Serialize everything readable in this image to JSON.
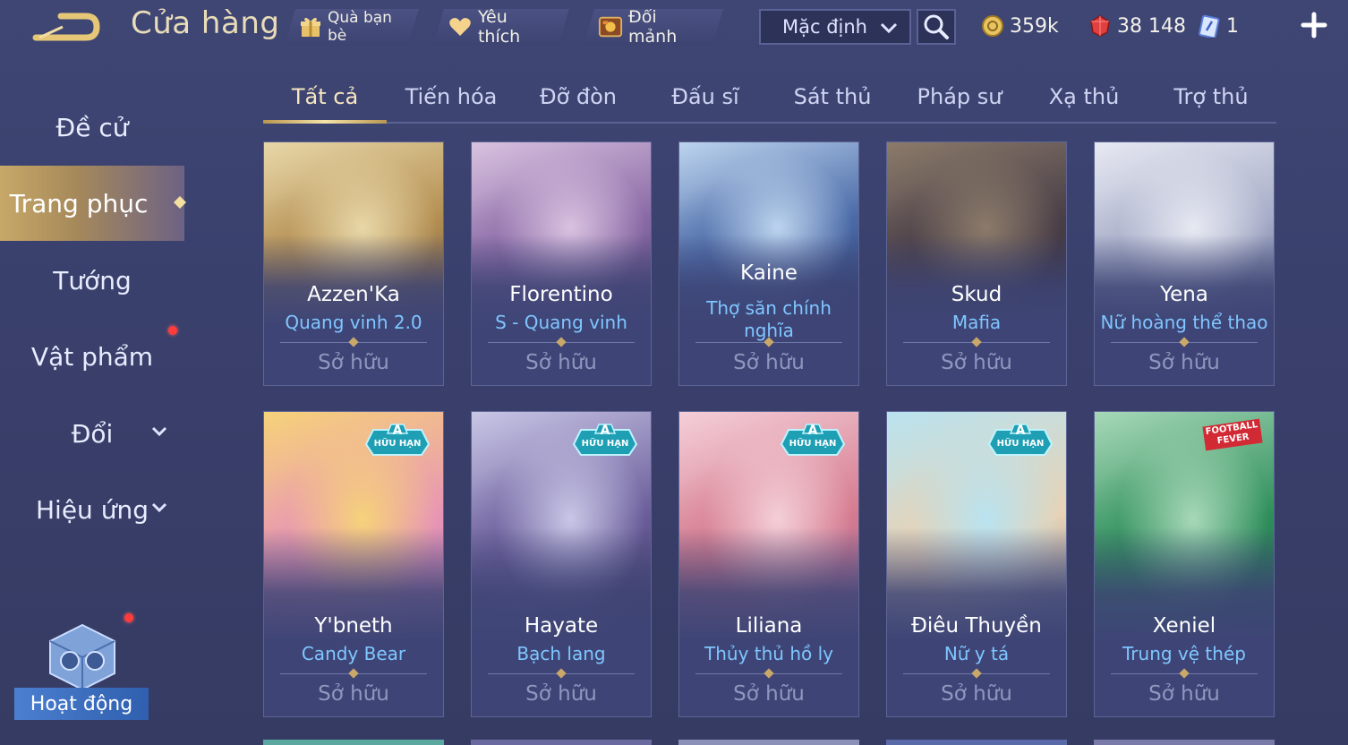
{
  "header": {
    "title": "Cửa hàng",
    "buttons": [
      {
        "label": "Quà bạn bè",
        "icon": "gift-icon"
      },
      {
        "label": "Yêu thích",
        "icon": "heart-icon"
      },
      {
        "label": "Đổi mảnh",
        "icon": "fragment-chest-icon"
      }
    ],
    "sort_value": "Mặc định",
    "currencies": [
      {
        "value": "359k",
        "icon": "gold-coin-icon"
      },
      {
        "value": "38 148",
        "icon": "ruby-gem-icon"
      },
      {
        "value": "1",
        "icon": "voucher-card-icon"
      }
    ]
  },
  "sidebar": {
    "items": [
      {
        "label": "Đề cử"
      },
      {
        "label": "Trang phục",
        "active": true
      },
      {
        "label": "Tướng"
      },
      {
        "label": "Vật phẩm",
        "dot": true
      },
      {
        "label": "Đổi",
        "dropdown": true
      },
      {
        "label": "Hiệu ứng",
        "dropdown": true
      }
    ],
    "event_label": "Hoạt động"
  },
  "tabs": [
    "Tất cả",
    "Tiến hóa",
    "Đỡ đòn",
    "Đấu sĩ",
    "Sát thủ",
    "Pháp sư",
    "Xạ thủ",
    "Trợ thủ"
  ],
  "badge": {
    "letter": "A",
    "text": "HỮU HẠN"
  },
  "fever_badge": "FOOTBALL FEVER",
  "cards": [
    {
      "hero": "Azzen'Ka",
      "skin": "Quang vinh 2.0",
      "status": "Sở hữu",
      "limited": false,
      "colors": [
        "#e8d7a8",
        "#b48f52",
        "#4d3b3a"
      ]
    },
    {
      "hero": "Florentino",
      "skin": "S - Quang vinh",
      "status": "Sở hữu",
      "limited": false,
      "colors": [
        "#d9c2e0",
        "#8a6aa6",
        "#3e3460"
      ]
    },
    {
      "hero": "Kaine",
      "skin": "Thợ săn chính nghĩa",
      "status": "Sở hữu",
      "limited": false,
      "colors": [
        "#bcd4ee",
        "#4b6aa8",
        "#1f2a55"
      ]
    },
    {
      "hero": "Skud",
      "skin": "Mafia",
      "status": "Sở hữu",
      "limited": false,
      "colors": [
        "#8c7b6a",
        "#4a3f48",
        "#252238"
      ]
    },
    {
      "hero": "Yena",
      "skin": "Nữ hoàng thể thao",
      "status": "Sở hữu",
      "limited": false,
      "colors": [
        "#e7e9f2",
        "#a7adc8",
        "#3a4470"
      ]
    },
    {
      "hero": "Y'bneth",
      "skin": "Candy Bear",
      "status": "Sở hữu",
      "limited": true,
      "colors": [
        "#f6d27a",
        "#e895b4",
        "#b27bcc"
      ]
    },
    {
      "hero": "Hayate",
      "skin": "Bạch lang",
      "status": "Sở hữu",
      "limited": true,
      "colors": [
        "#c9c6e6",
        "#6a5d9a",
        "#2e2748"
      ]
    },
    {
      "hero": "Liliana",
      "skin": "Thủy thủ hồ ly",
      "status": "Sở hữu",
      "limited": true,
      "colors": [
        "#f4cfd8",
        "#d57a8e",
        "#7a6ab2"
      ]
    },
    {
      "hero": "Điêu Thuyền",
      "skin": "Nữ y tá",
      "status": "Sở hữu",
      "limited": true,
      "colors": [
        "#b9e3f0",
        "#e7d2b5",
        "#3d5c98"
      ]
    },
    {
      "hero": "Xeniel",
      "skin": "Trung vệ thép",
      "status": "Sở hữu",
      "limited": false,
      "colors": [
        "#a7d8b8",
        "#2f8f5b",
        "#1d3e53"
      ]
    }
  ]
}
